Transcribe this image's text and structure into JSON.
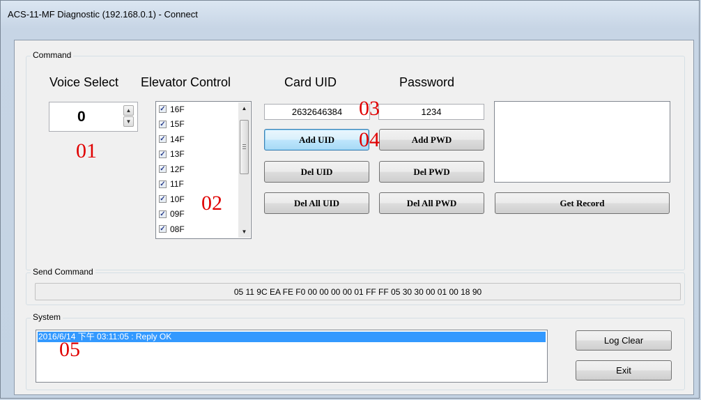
{
  "window": {
    "title": "ACS-11-MF Diagnostic (192.168.0.1) - Connect"
  },
  "command_group": {
    "label": "Command",
    "voice_select": {
      "label": "Voice Select",
      "value": "0"
    },
    "elevator": {
      "label": "Elevator Control",
      "floors": [
        {
          "name": "16F",
          "checked": true
        },
        {
          "name": "15F",
          "checked": true
        },
        {
          "name": "14F",
          "checked": true
        },
        {
          "name": "13F",
          "checked": true
        },
        {
          "name": "12F",
          "checked": true
        },
        {
          "name": "11F",
          "checked": true
        },
        {
          "name": "10F",
          "checked": true
        },
        {
          "name": "09F",
          "checked": true
        },
        {
          "name": "08F",
          "checked": true
        }
      ]
    },
    "card_uid": {
      "label": "Card UID",
      "value": "2632646384"
    },
    "password": {
      "label": "Password",
      "value": "1234"
    },
    "buttons": {
      "add_uid": "Add UID",
      "add_pwd": "Add PWD",
      "del_uid": "Del UID",
      "del_pwd": "Del PWD",
      "del_all_uid": "Del All UID",
      "del_all_pwd": "Del All PWD",
      "get_record": "Get Record"
    },
    "record_text": ""
  },
  "send_command": {
    "label": "Send Command",
    "value": "05 11 9C EA FE F0 00 00 00 00 01 FF FF 05 30 30 00 01 00 18 90"
  },
  "system": {
    "label": "System",
    "log": [
      "2016/6/14 下午 03:11:05 : Reply OK"
    ],
    "buttons": {
      "log_clear": "Log Clear",
      "exit": "Exit"
    }
  },
  "annotations": [
    "01",
    "02",
    "03",
    "04",
    "05"
  ],
  "colors": {
    "selection": "#3399ff",
    "annotation": "#e00000"
  }
}
